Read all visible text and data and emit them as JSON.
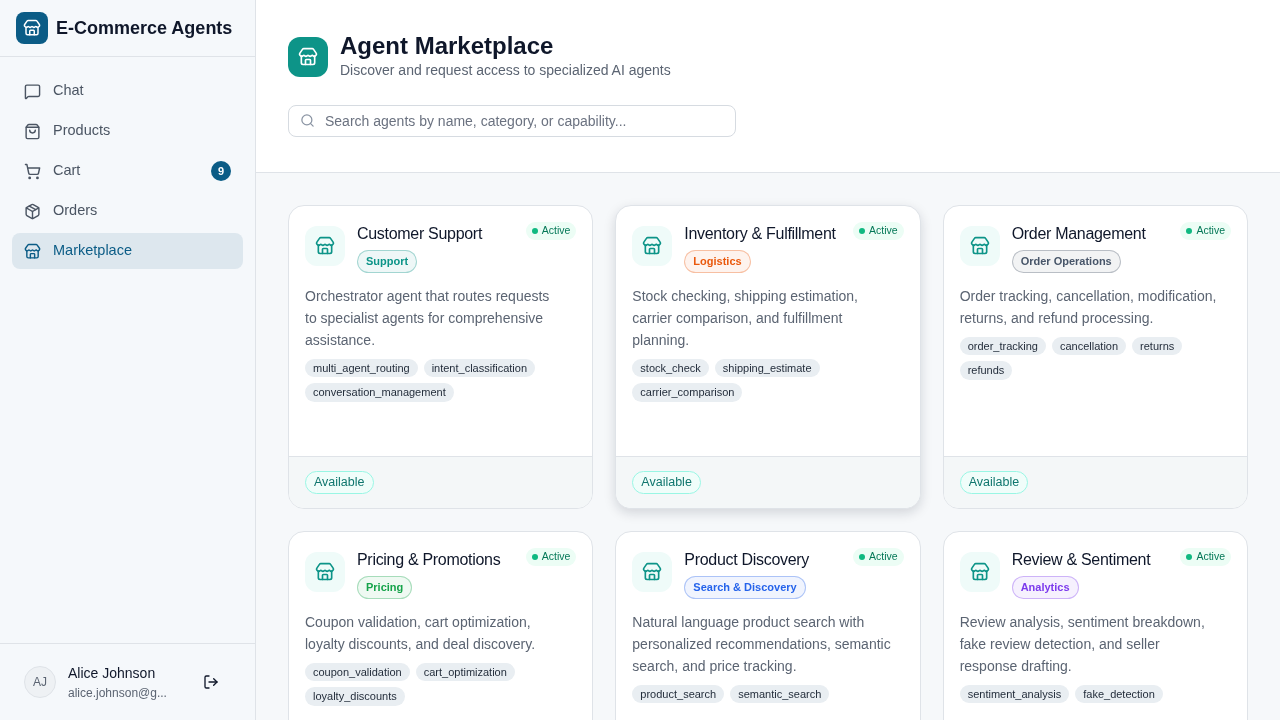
{
  "app": {
    "title": "E-Commerce Agents"
  },
  "nav": [
    {
      "label": "Chat",
      "selected": false
    },
    {
      "label": "Products",
      "selected": false
    },
    {
      "label": "Cart",
      "selected": false,
      "badge": "9"
    },
    {
      "label": "Orders",
      "selected": false
    },
    {
      "label": "Marketplace",
      "selected": true
    }
  ],
  "user": {
    "initials": "AJ",
    "name": "Alice Johnson",
    "email": "alice.johnson@g..."
  },
  "header": {
    "title": "Agent Marketplace",
    "subtitle": "Discover and request access to specialized AI agents"
  },
  "search": {
    "placeholder": "Search agents by name, category, or capability..."
  },
  "agents": [
    {
      "name": "Customer Support",
      "category": "Support",
      "color": "#0d9488",
      "status": "Active",
      "active": true,
      "description": "Orchestrator agent that routes requests to specialist agents for comprehensive assistance.",
      "capabilities": [
        "multi_agent_routing",
        "intent_classification",
        "conversation_management"
      ],
      "availability": "Available",
      "hovered": false
    },
    {
      "name": "Inventory & Fulfillment",
      "category": "Logistics",
      "color": "#ea580c",
      "status": "Active",
      "active": true,
      "description": "Stock checking, shipping estimation, carrier comparison, and fulfillment planning.",
      "capabilities": [
        "stock_check",
        "shipping_estimate",
        "carrier_comparison"
      ],
      "availability": "Available",
      "hovered": true
    },
    {
      "name": "Order Management",
      "category": "Order Operations",
      "color": "#475569",
      "status": "Active",
      "active": true,
      "description": "Order tracking, cancellation, modification, returns, and refund processing.",
      "capabilities": [
        "order_tracking",
        "cancellation",
        "returns",
        "refunds"
      ],
      "availability": "Available",
      "hovered": false
    },
    {
      "name": "Pricing & Promotions",
      "category": "Pricing",
      "color": "#16a34a",
      "status": "Active",
      "active": true,
      "description": "Coupon validation, cart optimization, loyalty discounts, and deal discovery.",
      "capabilities": [
        "coupon_validation",
        "cart_optimization",
        "loyalty_discounts"
      ],
      "hovered": false
    },
    {
      "name": "Product Discovery",
      "category": "Search & Discovery",
      "color": "#2563eb",
      "status": "Active",
      "active": true,
      "description": "Natural language product search with personalized recommendations, semantic search, and price tracking.",
      "capabilities": [
        "product_search",
        "semantic_search"
      ],
      "hovered": false
    },
    {
      "name": "Review & Sentiment",
      "category": "Analytics",
      "color": "#7c3aed",
      "status": "Active",
      "active": true,
      "description": "Review analysis, sentiment breakdown, fake review detection, and seller response drafting.",
      "capabilities": [
        "sentiment_analysis",
        "fake_detection"
      ],
      "hovered": false
    }
  ]
}
